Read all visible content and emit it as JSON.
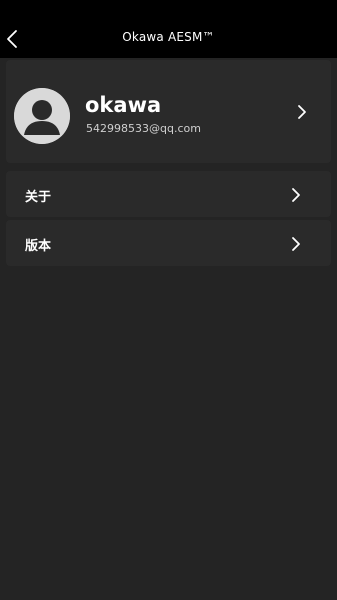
{
  "header": {
    "title": "Okawa AESM™",
    "back_icon": "back-chevron-icon"
  },
  "profile": {
    "username": "okawa",
    "email": "542998533@qq.com",
    "avatar_icon": "user-avatar-icon",
    "chevron_icon": "chevron-right-icon"
  },
  "menu": {
    "items": [
      {
        "label": "关于",
        "icon": "chevron-right-icon"
      },
      {
        "label": "版本",
        "icon": "chevron-right-icon"
      }
    ]
  },
  "colors": {
    "background": "#242424",
    "card": "#2a2a2a",
    "topbar": "#000000",
    "text": "#ffffff"
  }
}
